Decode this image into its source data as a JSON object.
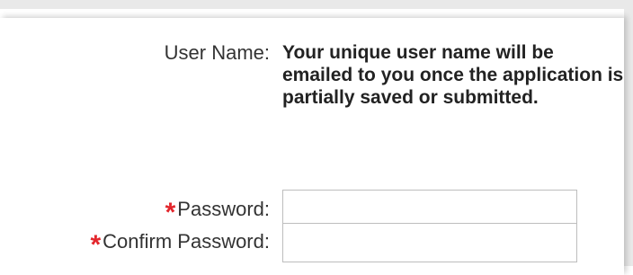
{
  "form": {
    "user_name": {
      "label": "User Name:",
      "value": "Your unique user name will be emailed to you once the application is partially saved or submitted."
    },
    "password": {
      "required_marker": "*",
      "label": "Password:",
      "value": ""
    },
    "confirm_password": {
      "required_marker": "*",
      "label": "Confirm Password:",
      "value": ""
    }
  },
  "colors": {
    "required": "#e3262c",
    "border": "#bdbdbd"
  }
}
